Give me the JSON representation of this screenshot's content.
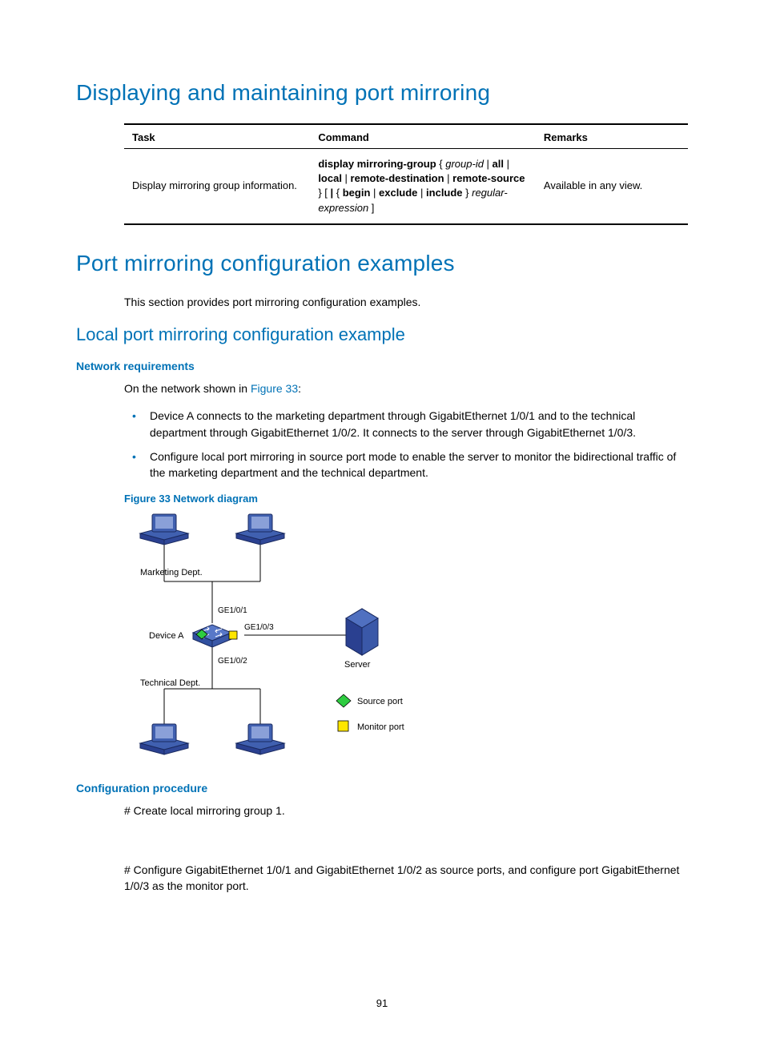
{
  "headings": {
    "h1a": "Displaying and maintaining port mirroring",
    "h1b": "Port mirroring configuration examples",
    "h2a": "Local port mirroring configuration example",
    "h3a": "Network requirements",
    "h3b": "Configuration procedure",
    "fig": "Figure 33 Network diagram"
  },
  "table": {
    "headers": {
      "task": "Task",
      "command": "Command",
      "remarks": "Remarks"
    },
    "row": {
      "task": "Display mirroring group information.",
      "cmd_prefix": "display mirroring-group",
      "cmd_body1": " { ",
      "cmd_groupid": "group-id",
      "cmd_pipe1": " | ",
      "cmd_all": "all",
      "cmd_pipe2": " | ",
      "cmd_local": "local",
      "cmd_pipe3": " | ",
      "cmd_rd": "remote-destination",
      "cmd_pipe4": " | ",
      "cmd_rs": "remote-source",
      "cmd_body2": " } [ ",
      "cmd_pipe5": "|",
      "cmd_body3": " { ",
      "cmd_begin": "begin",
      "cmd_pipe6": " | ",
      "cmd_exclude": "exclude",
      "cmd_pipe7": " | ",
      "cmd_include": "include",
      "cmd_body4": " } ",
      "cmd_regex": "regular-expression",
      "cmd_body5": " ]",
      "remarks": "Available in any view."
    }
  },
  "paras": {
    "intro": "This section provides port mirroring configuration examples.",
    "net_shown_pre": "On the network shown in ",
    "fig_link": "Figure 33",
    "net_shown_post": ":",
    "li1": "Device A connects to the marketing department through GigabitEthernet 1/0/1 and to the technical department through GigabitEthernet 1/0/2. It connects to the server through GigabitEthernet 1/0/3.",
    "li2": "Configure local port mirroring in source port mode to enable the server to monitor the bidirectional traffic of the marketing department and the technical department.",
    "conf1": "# Create local mirroring group 1.",
    "conf2": "# Configure GigabitEthernet 1/0/1 and GigabitEthernet 1/0/2 as source ports, and configure port GigabitEthernet 1/0/3 as the monitor port."
  },
  "diagram": {
    "marketing": "Marketing Dept.",
    "technical": "Technical Dept.",
    "devicea": "Device A",
    "server": "Server",
    "ge1": "GE1/0/1",
    "ge2": "GE1/0/2",
    "ge3": "GE1/0/3",
    "source_port": "Source port",
    "monitor_port": "Monitor port"
  },
  "page": "91"
}
